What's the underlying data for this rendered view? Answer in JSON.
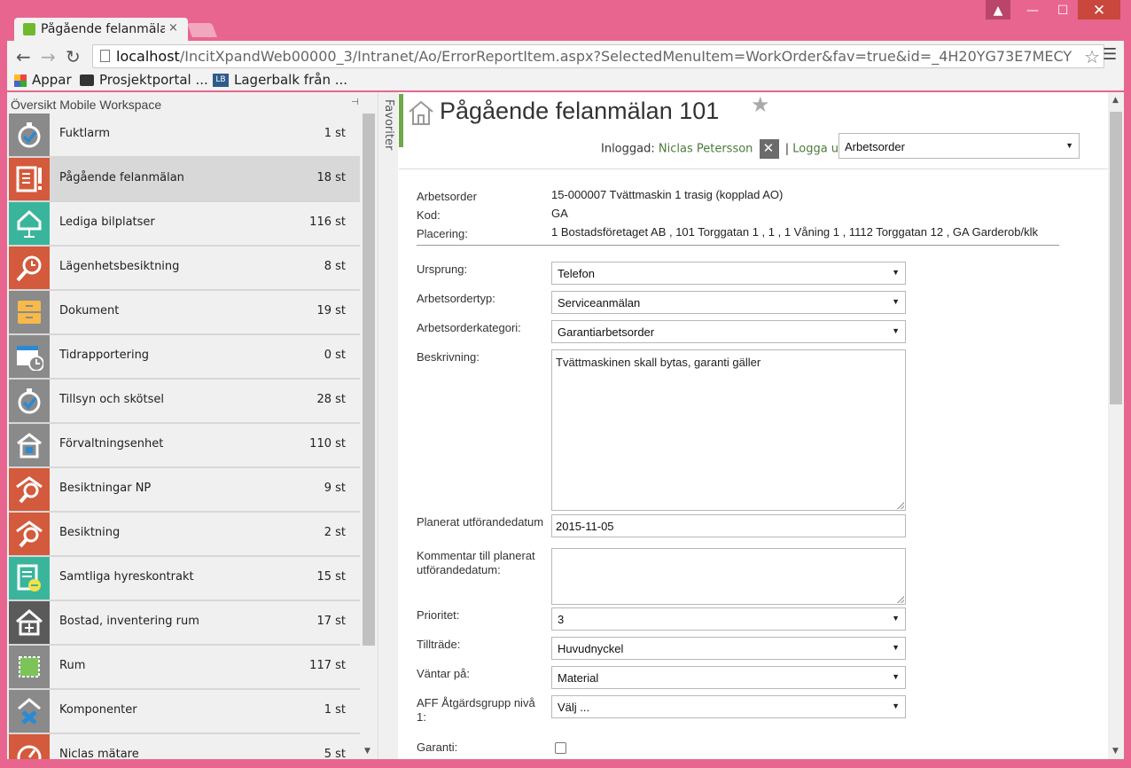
{
  "browser": {
    "tab_title": "Pågående felanmälan",
    "tab_close": "×",
    "window_user": "▲",
    "window_min": "—",
    "window_max": "☐",
    "window_close": "✕",
    "back": "←",
    "forward": "→",
    "reload": "↻",
    "url_host": "localhost",
    "url_path": "/IncitXpandWeb00000_3/Intranet/Ao/ErrorReportItem.aspx?SelectedMenuItem=WorkOrder&fav=true&id=_4H20YG73E7MECY",
    "bookmark_star": "☆",
    "menu_glyph": "☰",
    "bookmarks": [
      "Appar",
      "Prosjektportal ...",
      "Lagerbalk från ..."
    ],
    "lb_icon_text": "LB"
  },
  "left_panel": {
    "title": "Översikt Mobile Workspace",
    "pin": "⊣",
    "scroll_down": "▼",
    "items": [
      {
        "label": "Fuktlarm",
        "count": "1 st",
        "color": "#8a8a8a",
        "icon": "stopwatch-check-icon"
      },
      {
        "label": "Pågående felanmälan",
        "count": "18 st",
        "color": "#d35a3c",
        "icon": "report-exclamation-icon"
      },
      {
        "label": "Lediga bilplatser",
        "count": "116 st",
        "color": "#3ab59c",
        "icon": "house-sign-icon"
      },
      {
        "label": "Lägenhetsbesiktning",
        "count": "8 st",
        "color": "#d35a3c",
        "icon": "magnifier-clock-icon"
      },
      {
        "label": "Dokument",
        "count": "19 st",
        "color": "#8a8a8a",
        "icon": "cabinet-icon"
      },
      {
        "label": "Tidrapportering",
        "count": "0 st",
        "color": "#8a8a8a",
        "icon": "calendar-clock-icon"
      },
      {
        "label": "Tillsyn och skötsel",
        "count": "28 st",
        "color": "#8a8a8a",
        "icon": "stopwatch-check-icon"
      },
      {
        "label": "Förvaltningsenhet",
        "count": "110 st",
        "color": "#8a8a8a",
        "icon": "building-icon"
      },
      {
        "label": "Besiktningar NP",
        "count": "9 st",
        "color": "#d35a3c",
        "icon": "house-magnifier-icon"
      },
      {
        "label": "Besiktning",
        "count": "2 st",
        "color": "#d35a3c",
        "icon": "house-magnifier-icon"
      },
      {
        "label": "Samtliga hyreskontrakt",
        "count": "15 st",
        "color": "#3ab59c",
        "icon": "contract-icon"
      },
      {
        "label": "Bostad, inventering rum",
        "count": "17 st",
        "color": "#5a5a5a",
        "icon": "house-window-icon"
      },
      {
        "label": "Rum",
        "count": "117 st",
        "color": "#8a8a8a",
        "icon": "room-icon"
      },
      {
        "label": "Komponenter",
        "count": "1 st",
        "color": "#8a8a8a",
        "icon": "component-icon"
      },
      {
        "label": "Niclas mätare",
        "count": "5 st",
        "color": "#d35a3c",
        "icon": "meter-icon"
      }
    ]
  },
  "favorites_label": "Favoriter",
  "header": {
    "title": "Pågående felanmälan 101",
    "star": "★",
    "logged_in_label": "Inloggad:",
    "user": "Niclas Petersson",
    "separator": "|",
    "logout": "Logga ut",
    "type_select": "Arbetsorder"
  },
  "info": [
    {
      "label": "Arbetsorder",
      "value": "15-000007 Tvättmaskin 1 trasig (kopplad AO)"
    },
    {
      "label": "Kod:",
      "value": "GA"
    },
    {
      "label": "Placering:",
      "value": "1 Bostadsföretaget AB , 101 Torggatan 1 , 1 , 1 Våning 1 , 1112 Torggatan 12 , GA Garderob/klk"
    }
  ],
  "form": {
    "ursprung_label": "Ursprung:",
    "ursprung_value": "Telefon",
    "typ_label": "Arbetsordertyp:",
    "typ_value": "Serviceanmälan",
    "kategori_label": "Arbetsorderkategori:",
    "kategori_value": "Garantiarbetsorder",
    "beskrivning_label": "Beskrivning:",
    "beskrivning_value": "Tvättmaskinen skall bytas, garanti gäller",
    "planerat_label": "Planerat utförandedatum",
    "planerat_value": "2015-11-05",
    "kommentar_label": "Kommentar till planerat utförandedatum:",
    "kommentar_value": "",
    "prioritet_label": "Prioritet:",
    "prioritet_value": "3",
    "tilltrade_label": "Tillträde:",
    "tilltrade_value": "Huvudnyckel",
    "vantar_label": "Väntar på:",
    "vantar_value": "Material",
    "aff_label": "AFF Åtgärdsgrupp nivå 1:",
    "aff_value": "Välj ...",
    "garanti_label": "Garanti:",
    "caret": "▼"
  },
  "scroll": {
    "up": "▲",
    "down": "▼"
  }
}
